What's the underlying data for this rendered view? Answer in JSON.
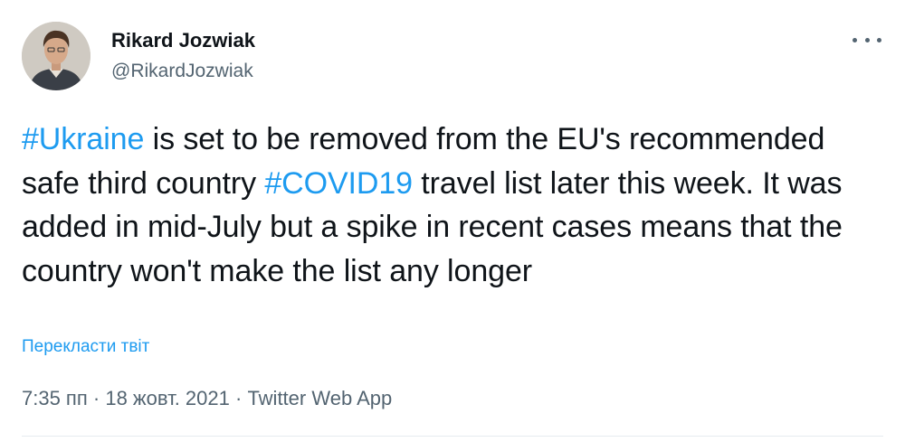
{
  "tweet": {
    "author": {
      "display_name": "Rikard Jozwiak",
      "handle": "@RikardJozwiak"
    },
    "more_icon": "ellipsis-icon",
    "body": {
      "hashtag1": "#Ukraine",
      "text1": " is set to be removed from the EU's recommended safe third country ",
      "hashtag2": "#COVID19",
      "text2": " travel list later this week. It was added in mid-July but a spike in recent cases means that the country won't make the list any longer"
    },
    "translate_label": "Перекласти твіт",
    "meta": {
      "time": "7:35 пп",
      "separator1": " · ",
      "date": "18 жовт. 2021",
      "separator2": " · ",
      "source": "Twitter Web App"
    },
    "colors": {
      "link": "#1d9bf0",
      "text": "#0f1419",
      "secondary": "#536471",
      "divider": "#e6ecf0"
    }
  }
}
